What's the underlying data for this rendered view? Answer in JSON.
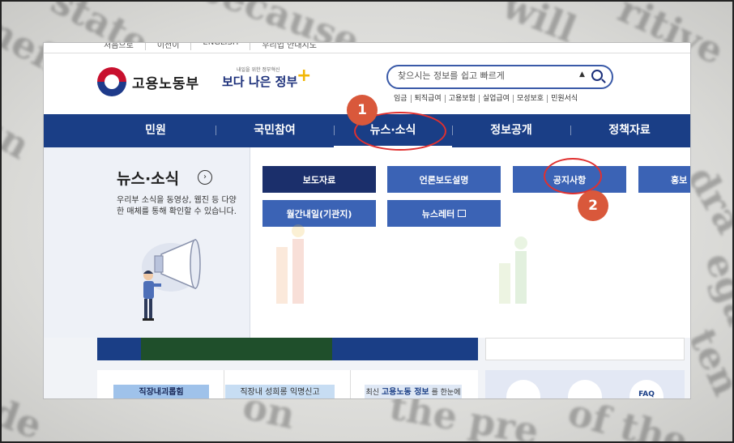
{
  "util_bar": [
    "처음으로",
    "이전이",
    "ENGLISH",
    "우리업 안내지도"
  ],
  "header": {
    "org_name": "고용노동부",
    "slogan_small": "내일을 위한 정부혁신",
    "slogan_big": "보다 나은 정부"
  },
  "search": {
    "placeholder": "찾으시는 정보를 쉽고 빠르게",
    "caret": "▲"
  },
  "quick_links": [
    "임금",
    "퇴직급여",
    "고용보험",
    "실업급여",
    "모성보호",
    "민원서식"
  ],
  "nav": {
    "tabs": [
      "민원",
      "국민참여",
      "뉴스·소식",
      "정보공개",
      "정책자료"
    ],
    "active": "뉴스·소식"
  },
  "panel": {
    "title": "뉴스·소식",
    "arrow": "›",
    "description": "우리부 소식을 동영상, 웹진 등 다양한 매체를 통해 확인할 수 있습니다.",
    "buttons_row1": [
      "보도자료",
      "언론보도설명",
      "공지사항",
      "홍보"
    ],
    "buttons_row2": [
      "월간내일(기관지)",
      "뉴스레터"
    ]
  },
  "annotations": [
    "1",
    "2"
  ],
  "lower": {
    "card1": "직장내괴롭힘",
    "card2": "직장내 성희롱 익명신고",
    "card3_prefix": "최신",
    "card3_highlight": "고용노동 정보",
    "card3_suffix": "를 한눈에",
    "faq": "FAQ"
  },
  "colors": {
    "nav_bg": "#1a3e86",
    "button_dark": "#1b2f6b",
    "button_mid": "#3b63b5",
    "annotation_red": "#e0302f",
    "badge_orange": "#d9583b"
  }
}
